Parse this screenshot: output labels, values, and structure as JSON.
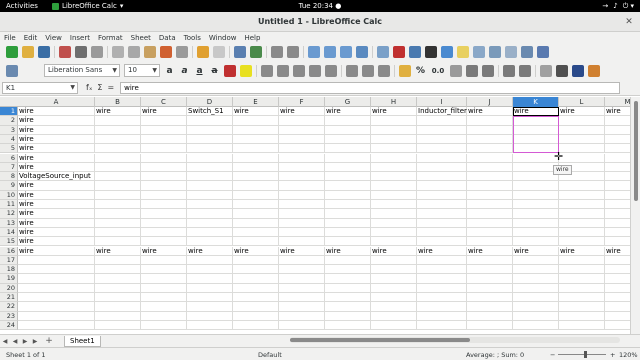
{
  "system_bar": {
    "activities": "Activities",
    "app_name": "LibreOffice Calc",
    "clock": "Tue 20:34 ●",
    "sys_icons": [
      "→",
      "♪",
      "⏻ ▾"
    ]
  },
  "window": {
    "title": "Untitled 1 - LibreOffice Calc",
    "close": "✕"
  },
  "menu": [
    "File",
    "Edit",
    "View",
    "Insert",
    "Format",
    "Sheet",
    "Data",
    "Tools",
    "Window",
    "Help"
  ],
  "toolbar": {
    "font_name": "Liberation Sans",
    "font_size": "10",
    "format_buttons": [
      "a",
      "a",
      "a",
      "a"
    ],
    "percent": "%",
    "number": "0.0"
  },
  "formula_bar": {
    "name_box": "K1",
    "fx_icons": [
      "fₓ",
      "Σ",
      "="
    ],
    "content": "wire"
  },
  "columns": [
    "A",
    "B",
    "C",
    "D",
    "E",
    "F",
    "G",
    "H",
    "I",
    "J",
    "K",
    "L",
    "M"
  ],
  "selected_column": "K",
  "selected_row": "1",
  "rows": [
    "1",
    "2",
    "3",
    "4",
    "5",
    "6",
    "7",
    "8",
    "9",
    "10",
    "11",
    "12",
    "13",
    "14",
    "15",
    "16",
    "17",
    "18",
    "19",
    "20",
    "21",
    "22",
    "23",
    "24"
  ],
  "cells": [
    {
      "r": "1",
      "c": "A",
      "v": "wire"
    },
    {
      "r": "1",
      "c": "B",
      "v": "wire"
    },
    {
      "r": "1",
      "c": "C",
      "v": "wire"
    },
    {
      "r": "1",
      "c": "D",
      "v": "Switch_S1"
    },
    {
      "r": "1",
      "c": "E",
      "v": "wire"
    },
    {
      "r": "1",
      "c": "F",
      "v": "wire"
    },
    {
      "r": "1",
      "c": "G",
      "v": "wire"
    },
    {
      "r": "1",
      "c": "H",
      "v": "wire"
    },
    {
      "r": "1",
      "c": "I",
      "v": "Inductor_filter"
    },
    {
      "r": "1",
      "c": "J",
      "v": "wire"
    },
    {
      "r": "1",
      "c": "K",
      "v": "wire"
    },
    {
      "r": "1",
      "c": "L",
      "v": "wire"
    },
    {
      "r": "1",
      "c": "M",
      "v": "wire"
    },
    {
      "r": "2",
      "c": "A",
      "v": "wire"
    },
    {
      "r": "3",
      "c": "A",
      "v": "wire"
    },
    {
      "r": "4",
      "c": "A",
      "v": "wire"
    },
    {
      "r": "5",
      "c": "A",
      "v": "wire"
    },
    {
      "r": "6",
      "c": "A",
      "v": "wire"
    },
    {
      "r": "7",
      "c": "A",
      "v": "wire"
    },
    {
      "r": "8",
      "c": "A",
      "v": "VoltageSource_input"
    },
    {
      "r": "9",
      "c": "A",
      "v": "wire"
    },
    {
      "r": "10",
      "c": "A",
      "v": "wire"
    },
    {
      "r": "11",
      "c": "A",
      "v": "wire"
    },
    {
      "r": "12",
      "c": "A",
      "v": "wire"
    },
    {
      "r": "13",
      "c": "A",
      "v": "wire"
    },
    {
      "r": "14",
      "c": "A",
      "v": "wire"
    },
    {
      "r": "15",
      "c": "A",
      "v": "wire"
    },
    {
      "r": "16",
      "c": "A",
      "v": "wire"
    },
    {
      "r": "16",
      "c": "B",
      "v": "wire"
    },
    {
      "r": "16",
      "c": "C",
      "v": "wire"
    },
    {
      "r": "16",
      "c": "D",
      "v": "wire"
    },
    {
      "r": "16",
      "c": "E",
      "v": "wire"
    },
    {
      "r": "16",
      "c": "F",
      "v": "wire"
    },
    {
      "r": "16",
      "c": "G",
      "v": "wire"
    },
    {
      "r": "16",
      "c": "H",
      "v": "wire"
    },
    {
      "r": "16",
      "c": "I",
      "v": "wire"
    },
    {
      "r": "16",
      "c": "J",
      "v": "wire"
    },
    {
      "r": "16",
      "c": "K",
      "v": "wire"
    },
    {
      "r": "16",
      "c": "L",
      "v": "wire"
    },
    {
      "r": "16",
      "c": "M",
      "v": "wire"
    }
  ],
  "drag_tooltip": "wire",
  "sheet_tabs": {
    "add": "+",
    "tabs": [
      "Sheet1"
    ],
    "nav": [
      "◀",
      "◀",
      "▶",
      "▶"
    ]
  },
  "status": {
    "sheet": "Sheet 1 of 1",
    "style": "Default",
    "sum": "Average: ; Sum: 0",
    "zoom": "120%",
    "zoom_minus": "−",
    "zoom_plus": "+"
  },
  "colors": {
    "selection_header": "#3a86d4",
    "drag_outline": "#d45ad4"
  }
}
